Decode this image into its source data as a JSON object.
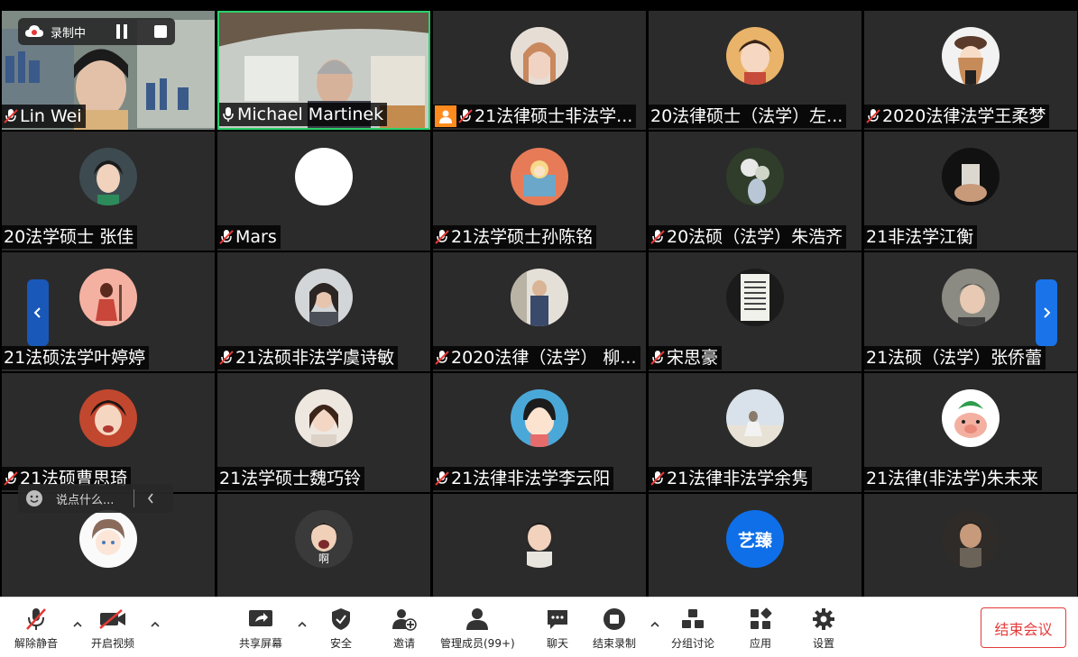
{
  "recording": {
    "label": "录制中"
  },
  "chat": {
    "placeholder": "说点什么..."
  },
  "tiles": [
    {
      "name": "Lin Wei",
      "muted": true
    },
    {
      "name": "Michael Martinek",
      "muted": false
    },
    {
      "name": "21法律硕士非法学...",
      "muted": true,
      "host_badge": true
    },
    {
      "name": "20法律硕士（法学）左...",
      "muted": false
    },
    {
      "name": "2020法律法学王柔梦",
      "muted": true
    },
    {
      "name": "20法学硕士 张佳",
      "muted": false
    },
    {
      "name": "Mars",
      "muted": true
    },
    {
      "name": "21法学硕士孙陈铭",
      "muted": true
    },
    {
      "name": "20法硕（法学）朱浩齐",
      "muted": true
    },
    {
      "name": "21非法学江衡",
      "muted": false
    },
    {
      "name": "21法硕法学叶婷婷",
      "muted": false
    },
    {
      "name": "21法硕非法学虞诗敏",
      "muted": true
    },
    {
      "name": "2020法律（法学） 柳...",
      "muted": true
    },
    {
      "name": "宋思豪",
      "muted": true
    },
    {
      "name": "21法硕（法学）张侨蕾",
      "muted": false
    },
    {
      "name": "21法硕曹思琦",
      "muted": true
    },
    {
      "name": "21法学硕士魏巧铃",
      "muted": false
    },
    {
      "name": "21法律非法学李云阳",
      "muted": true
    },
    {
      "name": "21法律非法学余隽",
      "muted": true
    },
    {
      "name": "21法律(非法学)朱未来",
      "muted": false
    },
    {
      "name": "",
      "muted": false
    },
    {
      "name": "",
      "muted": false,
      "avatar_caption": "啊"
    },
    {
      "name": "",
      "muted": false
    },
    {
      "name": "",
      "muted": false,
      "avatar_text": "艺臻"
    },
    {
      "name": "",
      "muted": false
    }
  ],
  "toolbar": {
    "unmute": "解除静音",
    "start_video": "开启视频",
    "share_screen": "共享屏幕",
    "security": "安全",
    "invite": "邀请",
    "participants": "管理成员(99+)",
    "chat": "聊天",
    "end_recording": "结束录制",
    "breakout": "分组讨论",
    "apps": "应用",
    "settings": "设置",
    "end_meeting": "结束会议"
  },
  "colors": {
    "tile_bg": "#2b2b2b",
    "accent_blue": "#1a73e8",
    "end_red": "#e43b3b",
    "host_orange": "#ff8a1e",
    "active_speaker": "#2bd16a"
  }
}
